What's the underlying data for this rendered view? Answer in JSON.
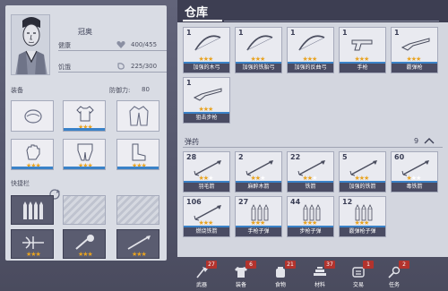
{
  "character": {
    "name": "冠奥",
    "health_label": "健康",
    "health_value": "400/455",
    "hunger_label": "饥饿",
    "hunger_value": "225/300"
  },
  "equipment": {
    "section_label": "装备",
    "defense_label": "防御力:",
    "defense_value": "80"
  },
  "quickbar": {
    "section_label": "快捷栏"
  },
  "warehouse": {
    "title": "仓库",
    "weapons": [
      {
        "count": "1",
        "name": "加强的木弓",
        "stars": 3
      },
      {
        "count": "1",
        "name": "加强的铁胎弓",
        "stars": 3
      },
      {
        "count": "1",
        "name": "加强的反曲弓",
        "stars": 3
      },
      {
        "count": "1",
        "name": "手枪",
        "stars": 3
      },
      {
        "count": "1",
        "name": "霰弹枪",
        "stars": 3
      },
      {
        "count": "1",
        "name": "狙击步枪",
        "stars": 3
      }
    ],
    "ammo_label": "弹药",
    "ammo_count": "9",
    "ammo": [
      {
        "count": "28",
        "name": "羽毛箭",
        "stars": 2
      },
      {
        "count": "2",
        "name": "麻醉木箭",
        "stars": 2
      },
      {
        "count": "22",
        "name": "铁箭",
        "stars": 2
      },
      {
        "count": "5",
        "name": "加强的铁箭",
        "stars": 3
      },
      {
        "count": "60",
        "name": "毒铁箭",
        "stars": 1
      },
      {
        "count": "106",
        "name": "燃烧铁箭",
        "stars": 3
      },
      {
        "count": "27",
        "name": "手枪子弹",
        "stars": 3
      },
      {
        "count": "44",
        "name": "步枪子弹",
        "stars": 3
      },
      {
        "count": "12",
        "name": "霰弹枪子弹",
        "stars": 3
      }
    ]
  },
  "bottom_nav": [
    {
      "label": "武器",
      "badge": "27",
      "icon": "axe-icon"
    },
    {
      "label": "装备",
      "badge": "6",
      "icon": "shirt-icon"
    },
    {
      "label": "食物",
      "badge": "21",
      "icon": "food-icon"
    },
    {
      "label": "材料",
      "badge": "37",
      "icon": "material-icon"
    },
    {
      "label": "交易",
      "badge": "1",
      "icon": "trade-icon"
    },
    {
      "label": "任务",
      "badge": "2",
      "icon": "quest-icon"
    }
  ],
  "colors": {
    "star": "#e8a321",
    "accent": "#3a82c8",
    "badge": "#b2332d",
    "header": "#3d3e52"
  }
}
